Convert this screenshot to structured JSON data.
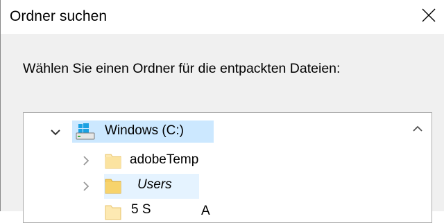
{
  "dialog": {
    "title": "Ordner suchen",
    "close_icon": "close-icon",
    "prompt": "Wählen Sie einen Ordner für die entpackten Dateien:"
  },
  "tree": {
    "root": {
      "label": "Windows (C:)",
      "icon": "windows-drive-icon",
      "expanded": true,
      "selected": true
    },
    "items": [
      {
        "label": "adobeTemp",
        "icon": "folder-icon",
        "expandable": true
      },
      {
        "label": "Users",
        "icon": "folder-icon",
        "expandable": true,
        "hovered": true
      }
    ],
    "partial_row": {
      "label_left": "5 S",
      "label_right": "A"
    },
    "scroll_up_icon": "scroll-up-icon"
  }
}
